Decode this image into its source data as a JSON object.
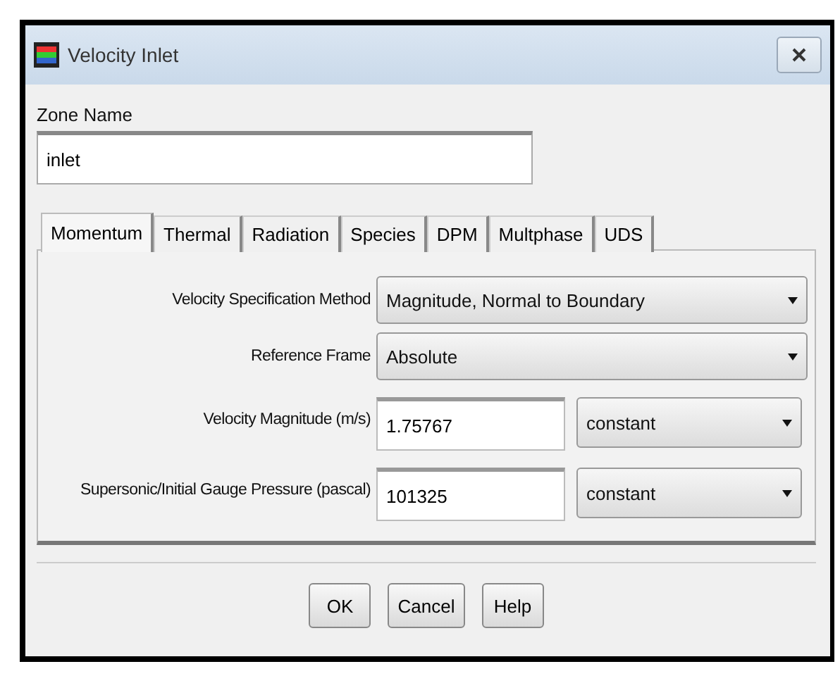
{
  "window": {
    "title": "Velocity Inlet"
  },
  "zone_name": {
    "label": "Zone Name",
    "value": "inlet"
  },
  "tabs": [
    {
      "label": "Momentum",
      "selected": true
    },
    {
      "label": "Thermal",
      "selected": false
    },
    {
      "label": "Radiation",
      "selected": false
    },
    {
      "label": "Species",
      "selected": false
    },
    {
      "label": "DPM",
      "selected": false
    },
    {
      "label": "Multphase",
      "selected": false
    },
    {
      "label": "UDS",
      "selected": false
    }
  ],
  "rows": [
    {
      "kind": "dropdown",
      "label": "Velocity Specification Method",
      "value": "Magnitude, Normal to Boundary"
    },
    {
      "kind": "dropdown",
      "label": "Reference Frame",
      "value": "Absolute"
    },
    {
      "kind": "input",
      "label": "Velocity Magnitude (m/s)",
      "value": "1.75767",
      "option": "constant"
    },
    {
      "kind": "input",
      "label": "Supersonic/Initial Gauge Pressure (pascal)",
      "value": "101325",
      "option": "constant"
    }
  ],
  "buttons": [
    "OK",
    "Cancel",
    "Help"
  ]
}
